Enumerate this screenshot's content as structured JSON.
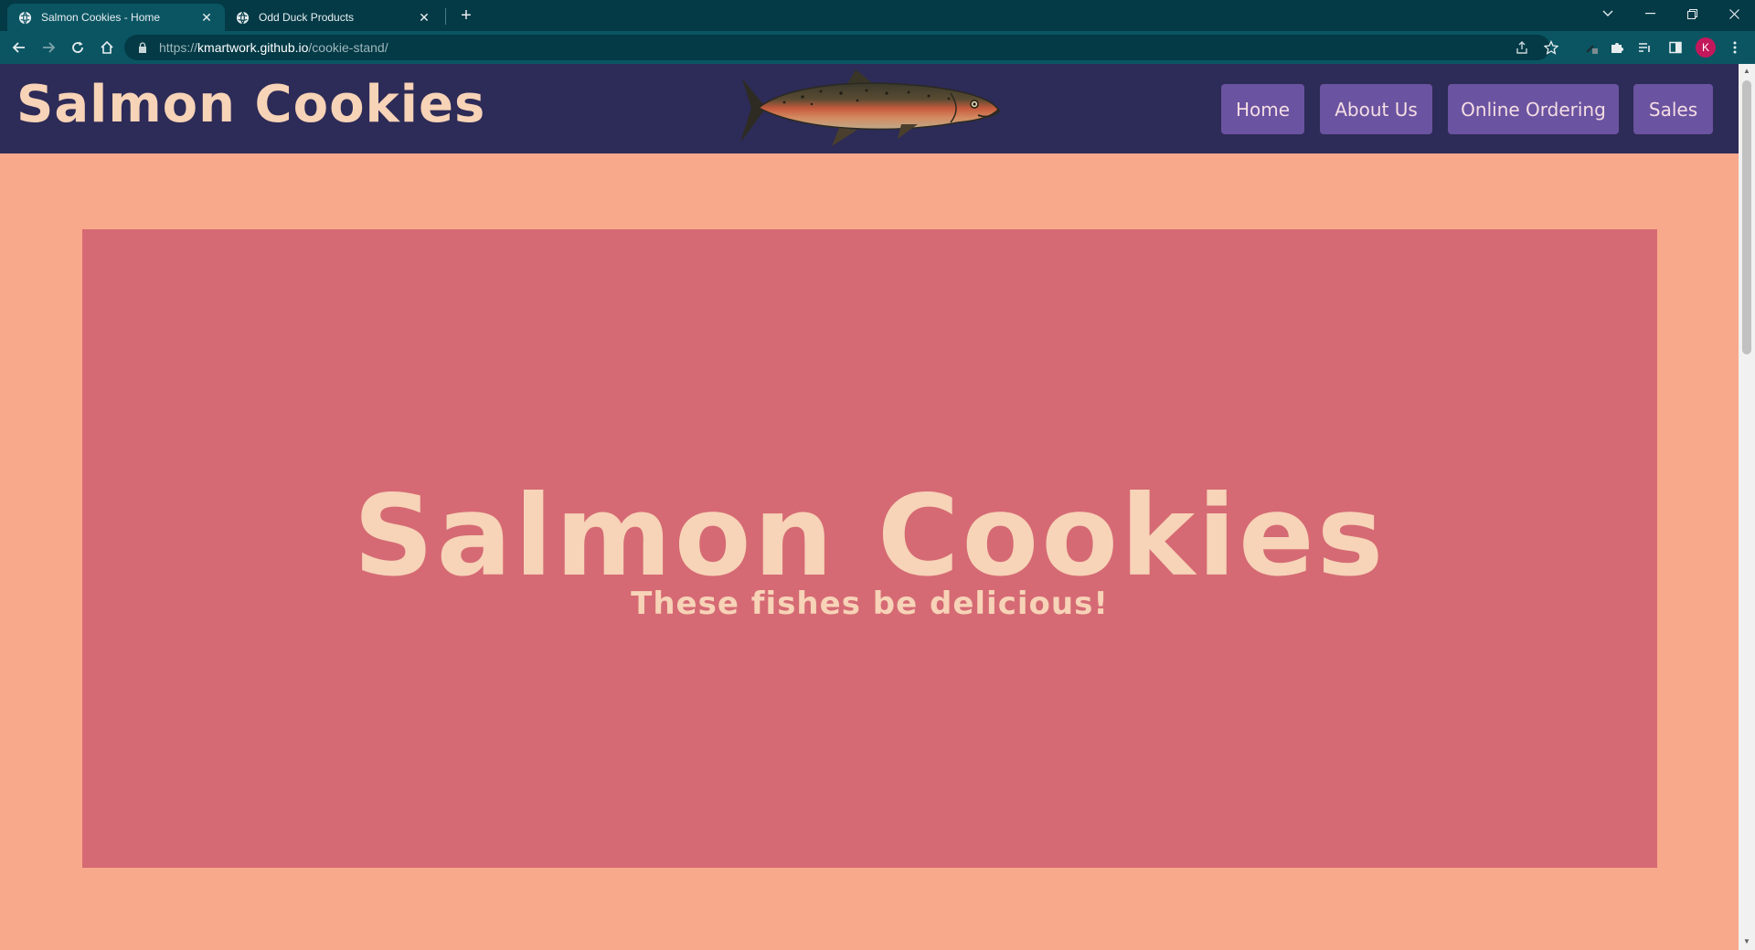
{
  "browser": {
    "tabs": [
      {
        "title": "Salmon Cookies - Home",
        "active": true
      },
      {
        "title": "Odd Duck Products",
        "active": false
      }
    ],
    "url": {
      "scheme": "https://",
      "host": "kmartwork.github.io",
      "path": "/cookie-stand/"
    },
    "profile_initial": "K",
    "icons": [
      "globe-icon",
      "close-icon",
      "plus-icon",
      "chevron-down-icon",
      "minimize-icon",
      "restore-icon",
      "close-window-icon",
      "back-arrow-icon",
      "forward-arrow-icon",
      "reload-icon",
      "home-icon",
      "lock-icon",
      "share-icon",
      "star-icon",
      "extension-icon",
      "puzzle-icon",
      "reading-list-icon",
      "side-panel-icon",
      "kebab-menu-icon"
    ]
  },
  "header": {
    "site_title": "Salmon Cookies",
    "logo": "salmon-fish-image",
    "nav": [
      {
        "label": "Home"
      },
      {
        "label": "About Us"
      },
      {
        "label": "Online Ordering"
      },
      {
        "label": "Sales"
      }
    ]
  },
  "hero": {
    "title": "Salmon Cookies",
    "subtitle": "These fishes be delicious!"
  },
  "colors": {
    "tabbar": "#033a46",
    "toolbar": "#0b5563",
    "page_background": "#f9a98b",
    "header_background": "#2d2b57",
    "nav_button": "#6a53a0",
    "hero_background": "#d56a74",
    "title_text": "#f7d3b7"
  }
}
